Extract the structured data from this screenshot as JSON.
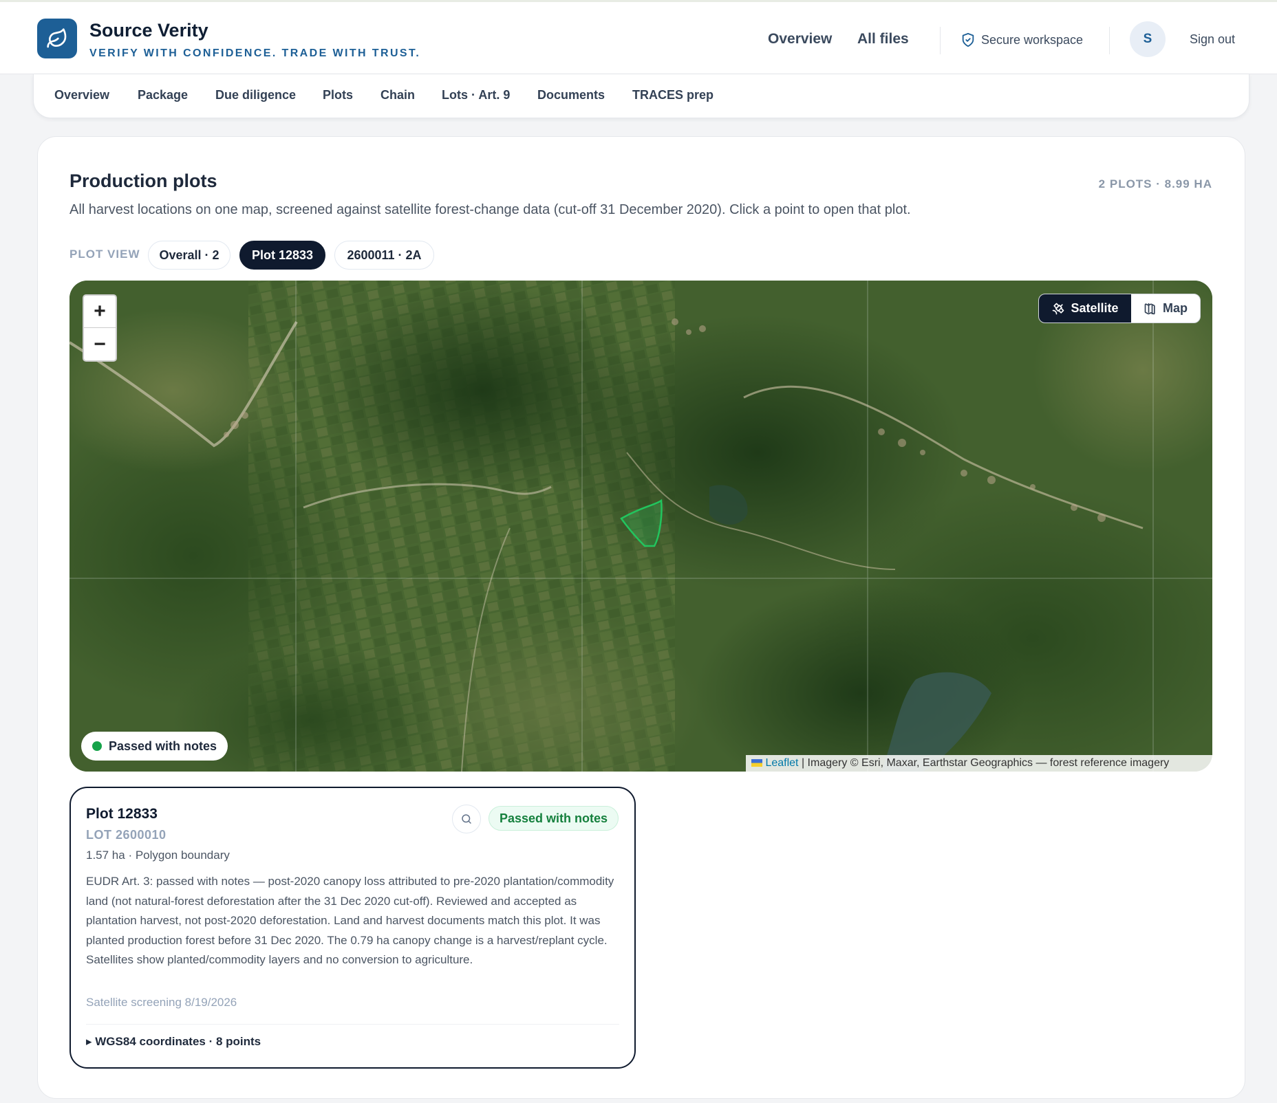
{
  "brand": {
    "name": "Source Verity",
    "tagline": "VERIFY WITH CONFIDENCE. TRADE WITH TRUST."
  },
  "topnav": {
    "overview": "Overview",
    "all_files": "All files",
    "secure": "Secure workspace",
    "avatar_initial": "S",
    "sign_out": "Sign out"
  },
  "tabs": [
    "Overview",
    "Package",
    "Due diligence",
    "Plots",
    "Chain",
    "Lots · Art. 9",
    "Documents",
    "TRACES prep"
  ],
  "section": {
    "title": "Production plots",
    "count": "2 PLOTS · 8.99 HA",
    "description": "All harvest locations on one map, screened against satellite forest-change data (cut-off 31 December 2020). Click a point to open that plot."
  },
  "plot_view": {
    "label": "PLOT VIEW",
    "pills": [
      "Overall · 2",
      "Plot 12833",
      "2600011 · 2A"
    ],
    "active_index": 1
  },
  "map": {
    "zoom_in": "+",
    "zoom_out": "−",
    "layer_satellite": "Satellite",
    "layer_map": "Map",
    "active_layer": "Satellite",
    "status": "Passed with notes",
    "status_color": "#16a34a",
    "attribution_leaflet": "Leaflet",
    "attribution_text": " | Imagery © Esri, Maxar, Earthstar Geographics — forest reference imagery"
  },
  "plot": {
    "title": "Plot 12833",
    "lot": "LOT 2600010",
    "meta": "1.57 ha · Polygon boundary",
    "badge": "Passed with notes",
    "description": "EUDR Art. 3: passed with notes — post-2020 canopy loss attributed to pre-2020 plantation/commodity land (not natural-forest deforestation after the 31 Dec 2020 cut-off). Reviewed and accepted as plantation harvest, not post-2020 deforestation. Land and harvest documents match this plot. It was planted production forest before 31 Dec 2020. The 0.79 ha canopy change is a harvest/replant cycle. Satellites show planted/commodity layers and no conversion to agriculture.",
    "screening_date": "Satellite screening 8/19/2026",
    "coords_summary": "▸ WGS84 coordinates · 8 points"
  },
  "colors": {
    "brand": "#1d5f96",
    "dark": "#0f1a2e",
    "success": "#15803d"
  }
}
